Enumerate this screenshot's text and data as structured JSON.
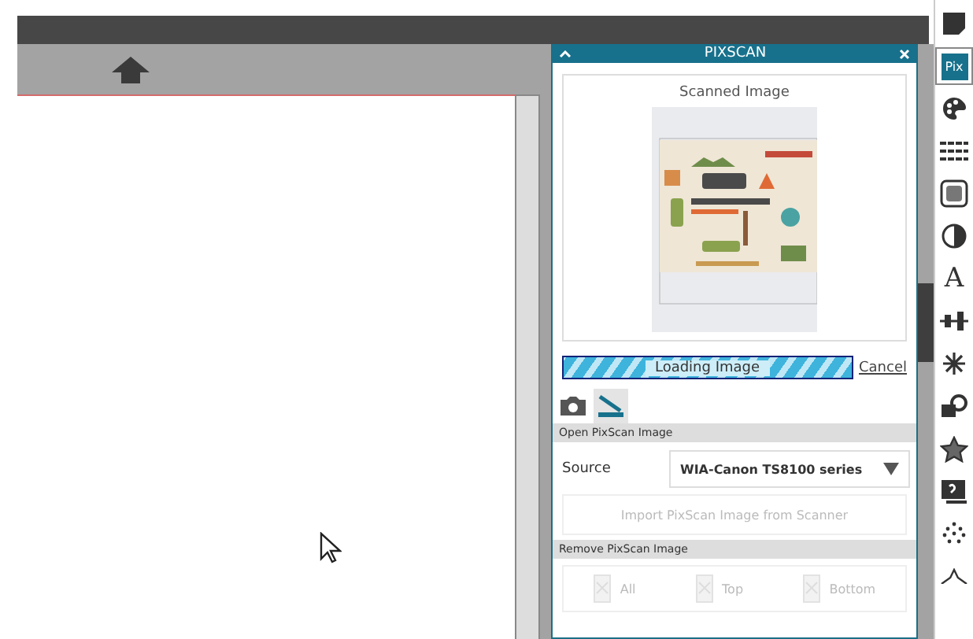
{
  "panel": {
    "title": "PIXSCAN",
    "heading": "Scanned Image",
    "progress": {
      "label": "Loading Image"
    },
    "cancel": "Cancel",
    "tabs": [
      {
        "kind": "camera",
        "selected": false
      },
      {
        "kind": "scanner",
        "selected": true
      }
    ],
    "open_section": "Open PixScan Image",
    "source": {
      "label": "Source",
      "value": "WIA-Canon TS8100 series"
    },
    "import": {
      "label": "Import PixScan Image from Scanner",
      "disabled": true
    },
    "remove_section": "Remove PixScan Image",
    "remove_buttons": [
      {
        "label": "All",
        "disabled": true
      },
      {
        "label": "Top",
        "disabled": true
      },
      {
        "label": "Bottom",
        "disabled": true
      }
    ]
  },
  "toolbar": [
    {
      "kind": "page",
      "selected": false
    },
    {
      "kind": "pix",
      "label": "Pix",
      "selected": true
    },
    {
      "kind": "palette",
      "selected": false
    },
    {
      "kind": "lines",
      "selected": false
    },
    {
      "kind": "frame",
      "selected": false
    },
    {
      "kind": "contrast",
      "selected": false
    },
    {
      "kind": "text",
      "label": "A",
      "selected": false
    },
    {
      "kind": "align",
      "selected": false
    },
    {
      "kind": "sparkle",
      "selected": false
    },
    {
      "kind": "shapes",
      "selected": false
    },
    {
      "kind": "star",
      "selected": false
    },
    {
      "kind": "trace",
      "selected": false
    },
    {
      "kind": "dots",
      "selected": false
    },
    {
      "kind": "star-outline",
      "selected": false
    }
  ]
}
